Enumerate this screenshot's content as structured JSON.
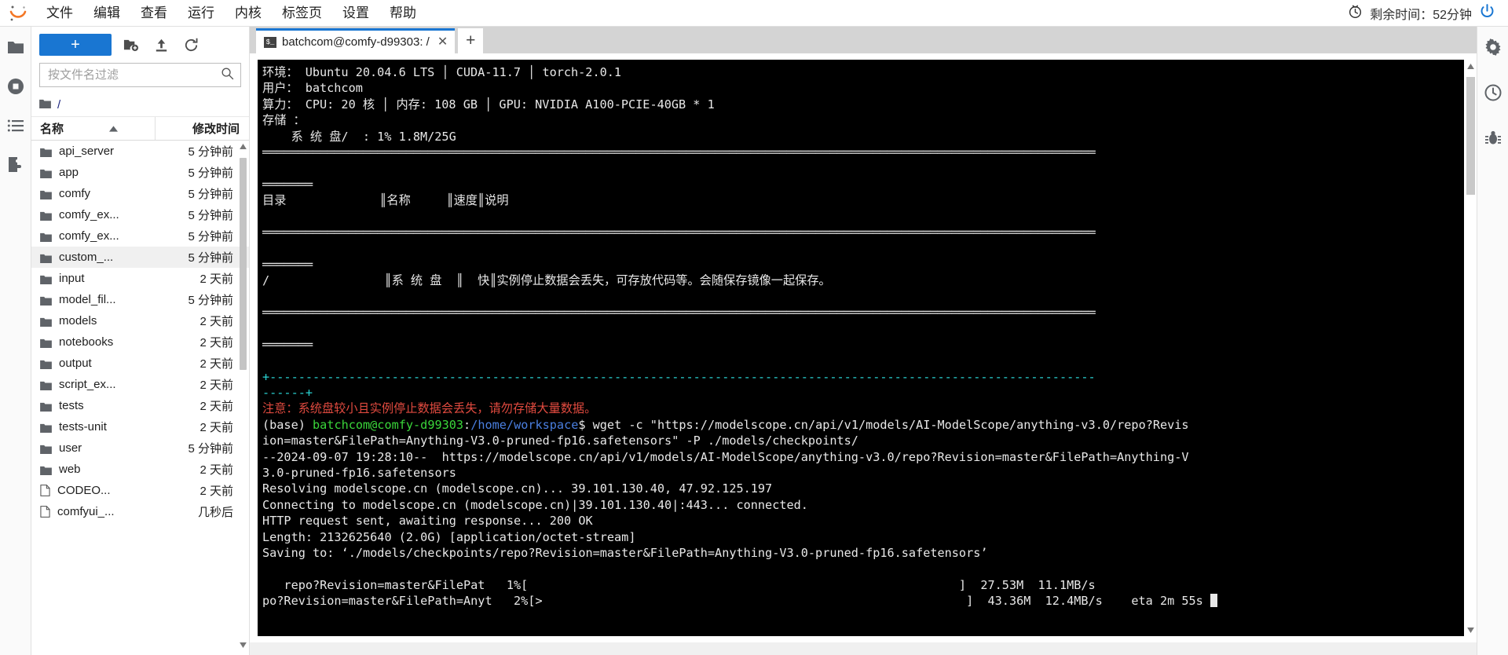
{
  "menubar": {
    "logo_name": "jupyter-logo",
    "items": [
      "文件",
      "编辑",
      "查看",
      "运行",
      "内核",
      "标签页",
      "设置",
      "帮助"
    ],
    "timer_label": "剩余时间：52分钟",
    "timer_icon": "clock-icon",
    "power_icon": "power-icon"
  },
  "rail_left": {
    "items": [
      {
        "name": "file-browser-icon",
        "label": "folder"
      },
      {
        "name": "running-terminals-icon",
        "label": "running"
      },
      {
        "name": "table-of-contents-icon",
        "label": "toc"
      },
      {
        "name": "extension-manager-icon",
        "label": "extensions"
      }
    ]
  },
  "rail_right": {
    "items": [
      {
        "name": "property-inspector-icon",
        "label": "settings"
      },
      {
        "name": "debugger-icon",
        "label": "debugger"
      },
      {
        "name": "bug-icon",
        "label": "bug"
      }
    ]
  },
  "filebrowser": {
    "new_button_label": "+",
    "new_folder_icon": "new-folder-icon",
    "upload_icon": "upload-icon",
    "refresh_icon": "refresh-icon",
    "filter_placeholder": "按文件名过滤",
    "filter_value": "",
    "search_icon": "search-icon",
    "breadcrumb": "/",
    "breadcrumb_icon": "folder-icon",
    "col_name": "名称",
    "col_modified": "修改时间",
    "sort_icon": "sort-ascending-icon",
    "rows": [
      {
        "name": "api_server",
        "time": "5 分钟前",
        "type": "folder",
        "selected": false
      },
      {
        "name": "app",
        "time": "5 分钟前",
        "type": "folder",
        "selected": false
      },
      {
        "name": "comfy",
        "time": "5 分钟前",
        "type": "folder",
        "selected": false
      },
      {
        "name": "comfy_ex...",
        "time": "5 分钟前",
        "type": "folder",
        "selected": false
      },
      {
        "name": "comfy_ex...",
        "time": "5 分钟前",
        "type": "folder",
        "selected": false
      },
      {
        "name": "custom_...",
        "time": "5 分钟前",
        "type": "folder",
        "selected": true
      },
      {
        "name": "input",
        "time": "2 天前",
        "type": "folder",
        "selected": false
      },
      {
        "name": "model_fil...",
        "time": "5 分钟前",
        "type": "folder",
        "selected": false
      },
      {
        "name": "models",
        "time": "2 天前",
        "type": "folder",
        "selected": false
      },
      {
        "name": "notebooks",
        "time": "2 天前",
        "type": "folder",
        "selected": false
      },
      {
        "name": "output",
        "time": "2 天前",
        "type": "folder",
        "selected": false
      },
      {
        "name": "script_ex...",
        "time": "2 天前",
        "type": "folder",
        "selected": false
      },
      {
        "name": "tests",
        "time": "2 天前",
        "type": "folder",
        "selected": false
      },
      {
        "name": "tests-unit",
        "time": "2 天前",
        "type": "folder",
        "selected": false
      },
      {
        "name": "user",
        "time": "5 分钟前",
        "type": "folder",
        "selected": false
      },
      {
        "name": "web",
        "time": "2 天前",
        "type": "folder",
        "selected": false
      },
      {
        "name": "CODEO...",
        "time": "2 天前",
        "type": "file",
        "selected": false
      },
      {
        "name": "comfyui_...",
        "time": "几秒后",
        "type": "file",
        "selected": false
      }
    ]
  },
  "main": {
    "tab": {
      "icon": "terminal-icon",
      "title": "batchcom@comfy-d99303: /",
      "close_label": "✕"
    },
    "add_tab_label": "+"
  },
  "terminal": {
    "lines": [
      [
        {
          "t": "环境： Ubuntu 20.04.6 LTS │ CUDA-11.7 │ torch-2.0.1",
          "c": "c-white"
        }
      ],
      [
        {
          "t": "用户： batchcom",
          "c": "c-white"
        }
      ],
      [
        {
          "t": "算力： CPU: 20 核 │ 内存: 108 GB │ GPU: NVIDIA A100-PCIE-40GB * 1",
          "c": "c-white"
        }
      ],
      [
        {
          "t": "存储 ：",
          "c": "c-white"
        }
      ],
      [
        {
          "t": "    系 统 盘/  : 1% 1.8M/25G",
          "c": "c-white"
        }
      ],
      [
        {
          "t": "════════════════════════════════════════════════════════════════════════════════════════════════════════════════════",
          "c": "c-white"
        }
      ],
      [
        {
          "t": "",
          "c": "c-white"
        }
      ],
      [
        {
          "t": "═══════",
          "c": "c-white"
        }
      ],
      [
        {
          "t": "目录             ║名称     ║速度║说明",
          "c": "c-white"
        }
      ],
      [
        {
          "t": "",
          "c": "c-white"
        }
      ],
      [
        {
          "t": "════════════════════════════════════════════════════════════════════════════════════════════════════════════════════",
          "c": "c-white"
        }
      ],
      [
        {
          "t": "",
          "c": "c-white"
        }
      ],
      [
        {
          "t": "═══════",
          "c": "c-white"
        }
      ],
      [
        {
          "t": "/                ║系 统 盘  ║  快║实例停止数据会丢失，可存放代码等。会随保存镜像一起保存。",
          "c": "c-white"
        }
      ],
      [
        {
          "t": "",
          "c": "c-white"
        }
      ],
      [
        {
          "t": "════════════════════════════════════════════════════════════════════════════════════════════════════════════════════",
          "c": "c-white"
        }
      ],
      [
        {
          "t": "",
          "c": "c-white"
        }
      ],
      [
        {
          "t": "═══════",
          "c": "c-white"
        }
      ],
      [
        {
          "t": "",
          "c": "c-white"
        }
      ],
      [
        {
          "t": "+-------------------------------------------------------------------------------------------------------------------",
          "c": "c-cyan"
        }
      ],
      [
        {
          "t": "------+",
          "c": "c-cyan"
        }
      ],
      [
        {
          "t": "注意：系统盘较小且实例停止数据会丢失，请勿存储大量数据。",
          "c": "c-red"
        }
      ],
      [
        {
          "t": "(base) ",
          "c": "c-white"
        },
        {
          "t": "batchcom@comfy-d99303",
          "c": "c-green"
        },
        {
          "t": ":",
          "c": "c-white"
        },
        {
          "t": "/home/workspace",
          "c": "c-blue"
        },
        {
          "t": "$ wget -c \"https://modelscope.cn/api/v1/models/AI-ModelScope/anything-v3.0/repo?Revis",
          "c": "c-white"
        }
      ],
      [
        {
          "t": "ion=master&FilePath=Anything-V3.0-pruned-fp16.safetensors\" -P ./models/checkpoints/",
          "c": "c-white"
        }
      ],
      [
        {
          "t": "--2024-09-07 19:28:10--  https://modelscope.cn/api/v1/models/AI-ModelScope/anything-v3.0/repo?Revision=master&FilePath=Anything-V",
          "c": "c-white"
        }
      ],
      [
        {
          "t": "3.0-pruned-fp16.safetensors",
          "c": "c-white"
        }
      ],
      [
        {
          "t": "Resolving modelscope.cn (modelscope.cn)... 39.101.130.40, 47.92.125.197",
          "c": "c-white"
        }
      ],
      [
        {
          "t": "Connecting to modelscope.cn (modelscope.cn)|39.101.130.40|:443... connected.",
          "c": "c-white"
        }
      ],
      [
        {
          "t": "HTTP request sent, awaiting response... 200 OK",
          "c": "c-white"
        }
      ],
      [
        {
          "t": "Length: 2132625640 (2.0G) [application/octet-stream]",
          "c": "c-white"
        }
      ],
      [
        {
          "t": "Saving to: ‘./models/checkpoints/repo?Revision=master&FilePath=Anything-V3.0-pruned-fp16.safetensors’",
          "c": "c-white"
        }
      ],
      [
        {
          "t": "",
          "c": "c-white"
        }
      ],
      [
        {
          "t": "   repo?Revision=master&FilePat   1%[                                                            ]  27.53M  11.1MB/s",
          "c": "c-white"
        }
      ],
      [
        {
          "t": "po?Revision=master&FilePath=Anyt   2%[>                                                           ]  43.36M  12.4MB/s    eta 2m 55s ",
          "c": "c-white",
          "cursor": true
        }
      ]
    ],
    "scroll_up_icon": "scroll-up-arrow-icon",
    "scroll_down_icon": "scroll-down-arrow-icon"
  }
}
